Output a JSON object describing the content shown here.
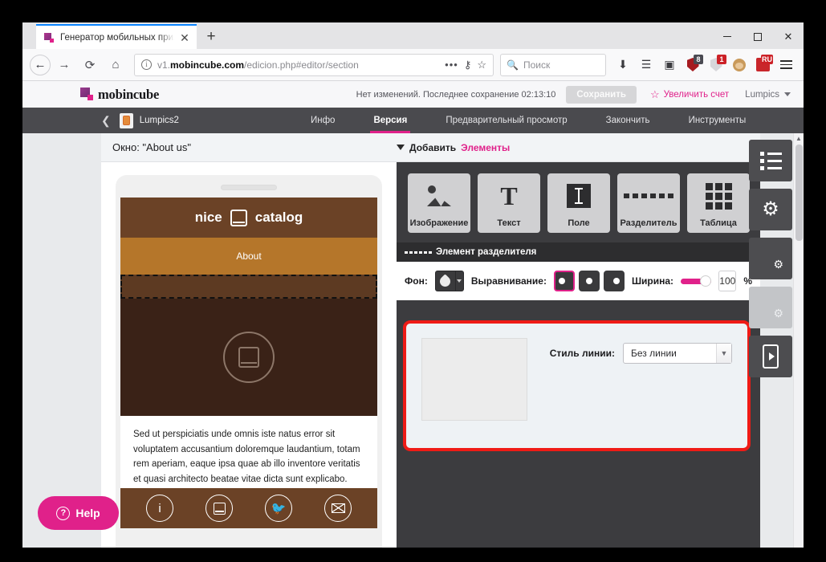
{
  "browser": {
    "tab": {
      "title": "Генератор мобильных прило",
      "close_label": "✕",
      "favicon": "mobincube-favicon"
    },
    "newtab_label": "+",
    "window_controls": {
      "minimize": "–",
      "maximize": "□",
      "close": "✕"
    },
    "nav": {
      "back": "←",
      "forward": "→",
      "reload": "⟳",
      "home": "⌂"
    },
    "url": {
      "prefix": "v1.",
      "domain": "mobincube.com",
      "path": "/edicion.php#editor/section",
      "info_icon": "i"
    },
    "url_actions": {
      "menu_dots": "•••",
      "reader": "shield-icon",
      "bookmark": "☆"
    },
    "search": {
      "placeholder": "Поиск",
      "icon": "search-icon"
    },
    "toolbar_icons": [
      {
        "name": "downloads-icon",
        "glyph": "⭳",
        "badge": ""
      },
      {
        "name": "library-icon",
        "glyph": "𝍌",
        "badge": ""
      },
      {
        "name": "sidebar-icon",
        "glyph": "▣",
        "badge": ""
      },
      {
        "name": "ublock-icon",
        "glyph": "",
        "badge": "8"
      },
      {
        "name": "adguard-icon",
        "glyph": "",
        "badge": "1"
      },
      {
        "name": "monkey-extension-icon",
        "glyph": "",
        "badge": ""
      },
      {
        "name": "ru-extension-icon",
        "glyph": "",
        "badge": "RU"
      }
    ],
    "menu_label": "≡"
  },
  "app": {
    "logo_text": "mobincube",
    "status": "Нет изменений. Последнее сохранение",
    "status_time": "02:13:10",
    "save_label": "Сохранить",
    "upgrade_label": "Увеличить счет",
    "account_label": "Lumpics",
    "nav": {
      "back_glyph": "❮",
      "project_name": "Lumpics2",
      "items": [
        {
          "label": "Инфо",
          "active": false
        },
        {
          "label": "Версия",
          "active": true
        },
        {
          "label": "Предварительный просмотр",
          "active": false
        },
        {
          "label": "Закончить",
          "active": false
        },
        {
          "label": "Инструменты",
          "active": false
        }
      ]
    }
  },
  "editor": {
    "window_title": "Окно: \"About us\"",
    "add_prefix": "Добавить",
    "add_target": "Элементы",
    "palette": [
      {
        "label": "Изображение",
        "icon": "image-icon"
      },
      {
        "label": "Текст",
        "icon": "text-icon"
      },
      {
        "label": "Поле",
        "icon": "field-icon"
      },
      {
        "label": "Разделитель",
        "icon": "separator-icon"
      },
      {
        "label": "Таблица",
        "icon": "table-icon"
      }
    ],
    "section_title": "Элемент разделителя",
    "properties": {
      "background_label": "Фон:",
      "align_label": "Выравнивание:",
      "align_options": [
        {
          "name": "align-left",
          "selected": true
        },
        {
          "name": "align-center",
          "selected": false
        },
        {
          "name": "align-right",
          "selected": false
        }
      ],
      "width_label": "Ширина:",
      "width_value": "100",
      "width_unit": "%"
    },
    "line_style": {
      "label": "Стиль линии:",
      "value": "Без линии"
    },
    "rail": [
      {
        "name": "list-settings-icon",
        "disabled": false
      },
      {
        "name": "gears-settings-icon",
        "disabled": false
      },
      {
        "name": "page-settings-icon",
        "disabled": false
      },
      {
        "name": "table-settings-icon",
        "disabled": true
      },
      {
        "name": "phone-preview-icon",
        "disabled": false
      }
    ]
  },
  "phone": {
    "header_left": "nice",
    "header_right": "catalog",
    "header_icon": "book-icon",
    "subtitle": "About",
    "center_icon": "book-circle-icon",
    "body_text": "Sed ut perspiciatis unde omnis iste natus error sit voluptatem accusantium doloremque laudantium, totam rem aperiam, eaque ipsa quae ab illo inventore veritatis et quasi architecto beatae vitae dicta sunt explicabo. Nemo",
    "footer_icons": [
      {
        "name": "info-icon",
        "glyph": "i"
      },
      {
        "name": "book-icon",
        "glyph": ""
      },
      {
        "name": "twitter-icon",
        "glyph": ""
      },
      {
        "name": "mail-icon",
        "glyph": ""
      }
    ]
  },
  "help": {
    "label": "Help",
    "icon": "question-icon",
    "glyph": "?"
  }
}
